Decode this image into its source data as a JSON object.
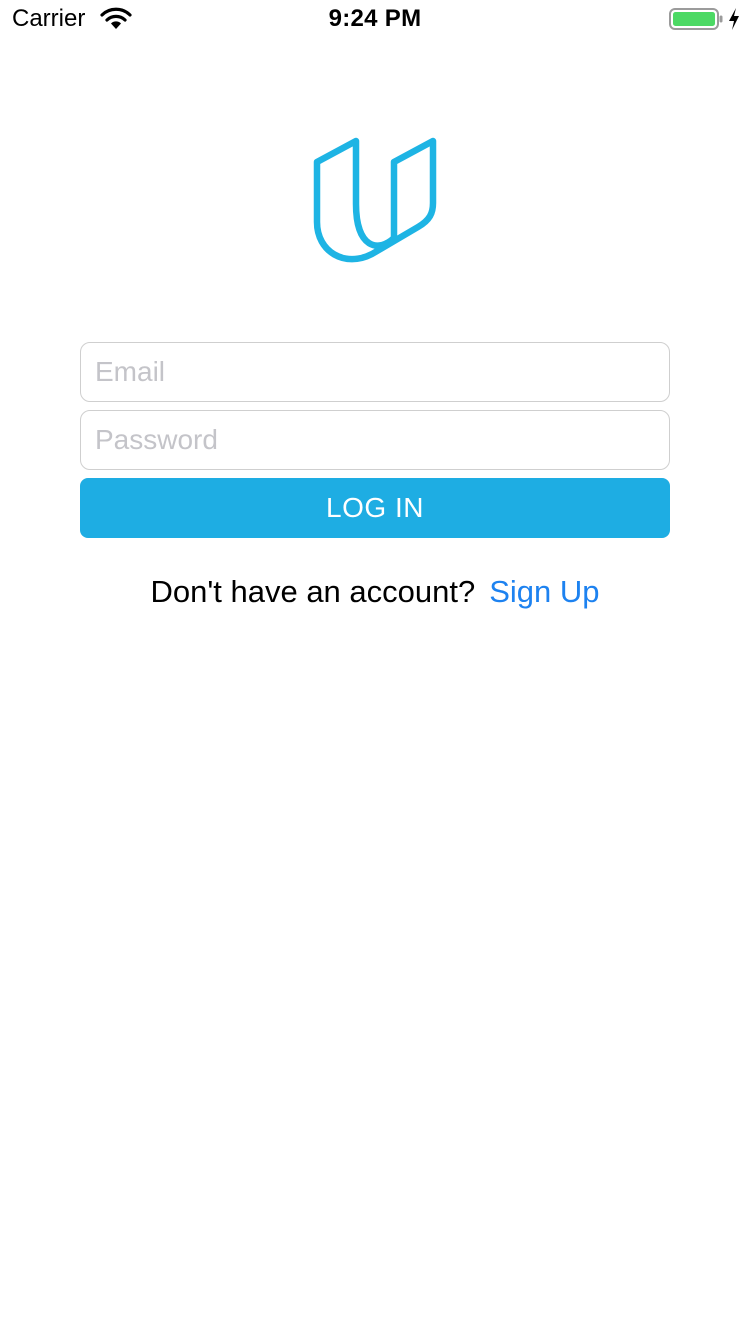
{
  "status_bar": {
    "carrier": "Carrier",
    "time": "9:24 PM",
    "battery_icon": "battery-charging-icon",
    "wifi_icon": "wifi-icon"
  },
  "logo": {
    "icon": "udacity-logo-icon",
    "color": "#1eb4e4"
  },
  "login_form": {
    "email_placeholder": "Email",
    "email_value": "",
    "password_placeholder": "Password",
    "password_value": "",
    "login_button_label": "LOG IN",
    "button_color": "#1eade3"
  },
  "signup": {
    "prompt": "Don't have an account?",
    "link_label": "Sign Up",
    "link_color": "#1d82f0"
  }
}
